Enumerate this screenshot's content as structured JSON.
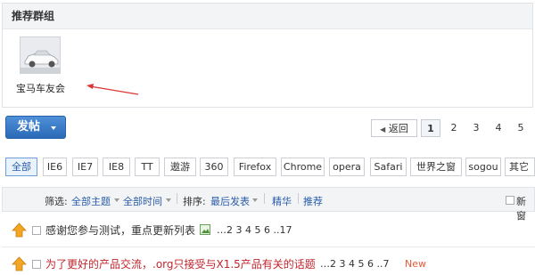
{
  "groups": {
    "heading": "推荐群组",
    "items": [
      {
        "name": "宝马车友会"
      }
    ]
  },
  "toolbar": {
    "post_label": "发帖",
    "pager": {
      "back": "返回",
      "current": "1",
      "pages": [
        "2",
        "3",
        "4",
        "5"
      ]
    }
  },
  "filters": {
    "tags": [
      "全部",
      "IE6",
      "IE7",
      "IE8",
      "TT",
      "遨游",
      "360",
      "Firefox",
      "Chrome",
      "opera",
      "Safari",
      "世界之窗",
      "sogou",
      "其它"
    ],
    "active_index": 0
  },
  "list_header": {
    "filter_label": "筛选:",
    "all_topics": "全部主题",
    "all_time": "全部时间",
    "sort_label": "排序:",
    "sort_value": "最后发表",
    "digest": "精华",
    "recommend": "推荐",
    "new_window": "新窗"
  },
  "threads": [
    {
      "title": "感谢您参与测试，重点更新列表",
      "pages": "…2 3 4 5 6 ..17",
      "title_color": "#333333",
      "has_attachment_icon": true,
      "new_badge": ""
    },
    {
      "title": "为了更好的产品交流，.org只接受与X1.5产品有关的话题",
      "pages": "…2 3 4 5 6 ..7",
      "title_color": "#c0262d",
      "has_attachment_icon": false,
      "new_badge": "New"
    }
  ],
  "colors": {
    "accent": "#2a69b7",
    "link": "#2a5caa",
    "hot_title": "#c0262d",
    "new_badge": "#e05a3a"
  }
}
